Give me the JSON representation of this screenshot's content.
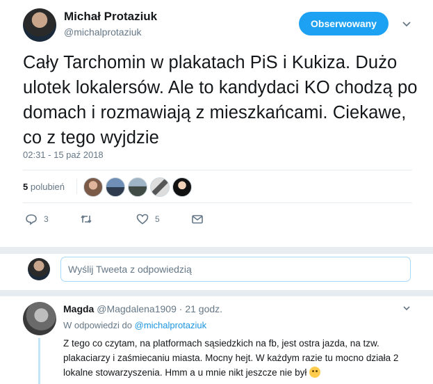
{
  "author": {
    "name": "Michał Protaziuk",
    "handle": "@michalprotaziuk",
    "follow_label": "Obserwowany"
  },
  "tweet": {
    "text": "Cały Tarchomin w plakatach PiS i Kukiza. Dużo ulotek lokalersów. Ale to kandydaci KO chodzą po domach i rozmawiają z mieszkańcami. Ciekawe, co z tego wyjdzie",
    "timestamp": "02:31 - 15 paź 2018",
    "likes_count": "5",
    "likes_label": "polubień"
  },
  "actions": {
    "reply_count": "3",
    "retweet_count": "",
    "like_count": "5"
  },
  "reply_composer": {
    "placeholder": "Wyślij Tweeta z odpowiedzią"
  },
  "reply": {
    "name": "Magda",
    "handle": "@Magdalena1909",
    "time": "21 godz.",
    "in_reply_prefix": "W odpowiedzi do",
    "in_reply_handle": "@michalprotaziuk",
    "text": "Z tego co czytam, na platformach sąsiedzkich na fb, jest ostra jazda, na tzw. plakaciarzy i zaśmiecaniu miasta. Mocny hejt. W każdym razie tu mocno działa 2 lokalne stowarzyszenia. Hmm a u mnie nikt jeszcze nie był"
  },
  "colors": {
    "accent": "#1da1f2",
    "muted": "#657786",
    "link": "#1b95e0"
  }
}
